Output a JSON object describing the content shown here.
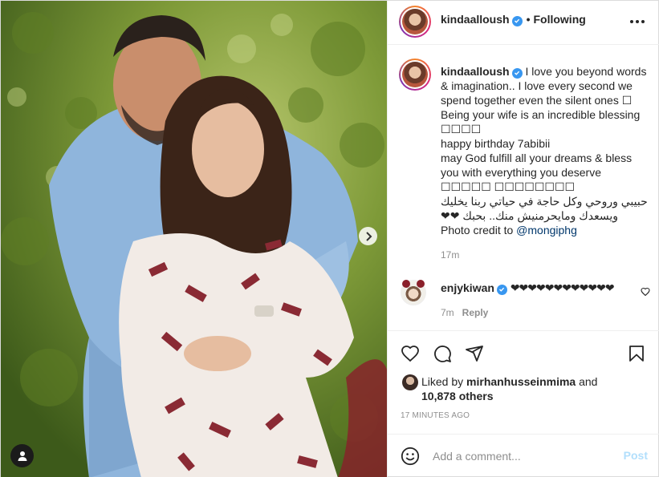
{
  "post": {
    "username": "kindaalloush",
    "separator": "•",
    "follow_status": "Following",
    "more_icon": "more-horizontal-icon"
  },
  "caption": {
    "username": "kindaalloush",
    "line1": "I love you beyond words & imagination.. I love every second we spend together even the silent ones ☐ Being your wife is an incredible blessing ☐☐☐☐",
    "line2": "happy birthday 7abibii",
    "line3": "may God fulfill all your dreams & bless you with everything you deserve ☐☐☐☐☐ ☐☐☐☐☐☐☐☐",
    "line4": "حبيبي وروحي وكل حاجة في حياتي ربنا يخليك ويسعدك ومايحرمنيش منك.. بحبك ❤❤",
    "credit_prefix": "Photo credit to ",
    "credit_mention": "@mongiphg",
    "time": "17m"
  },
  "comment": {
    "username": "enjykiwan",
    "text": "❤❤❤❤❤❤❤❤❤❤❤❤",
    "time": "7m",
    "reply_label": "Reply"
  },
  "actions": {
    "like_icon": "heart-icon",
    "comment_icon": "comment-icon",
    "share_icon": "share-icon",
    "save_icon": "bookmark-icon"
  },
  "likes": {
    "prefix": "Liked by ",
    "user": "mirhanhusseinmima",
    "mid": " and",
    "count": "10,878 others"
  },
  "timestamp": "17 MINUTES AGO",
  "composer": {
    "placeholder": "Add a comment...",
    "post_label": "Post",
    "emoji_icon": "emoji-icon"
  },
  "colors": {
    "link": "#00376b",
    "verified": "#3897f0",
    "post_disabled": "#b2dffc",
    "muted": "#8e8e8e"
  }
}
